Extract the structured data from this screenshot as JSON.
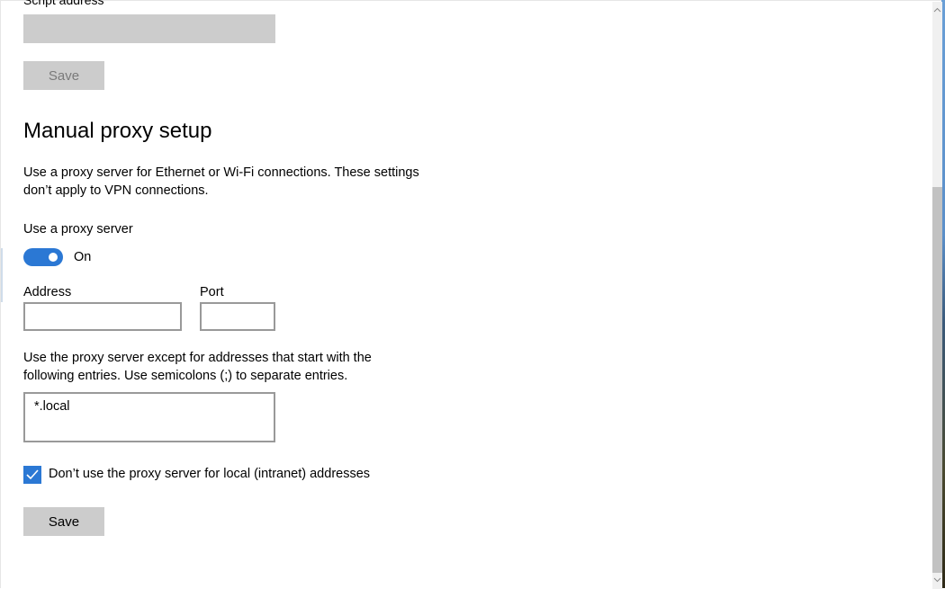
{
  "script_section": {
    "address_label": "Script address",
    "address_value": "",
    "save_label": "Save"
  },
  "manual_proxy": {
    "title": "Manual proxy setup",
    "description": "Use a proxy server for Ethernet or Wi-Fi connections. These settings don’t apply to VPN connections.",
    "use_proxy_label": "Use a proxy server",
    "use_proxy_state": "On",
    "address_label": "Address",
    "address_value": "",
    "port_label": "Port",
    "port_value": "",
    "exceptions_description": "Use the proxy server except for addresses that start with the following entries. Use semicolons (;) to separate entries.",
    "exceptions_value": "*.local",
    "bypass_local_label": "Don’t use the proxy server for local (intranet) addresses",
    "bypass_local_checked": true,
    "save_label": "Save"
  },
  "colors": {
    "accent": "#2b78d4",
    "disabled_fill": "#cccccc"
  },
  "icons": {
    "scroll_up": "chevron-up-icon",
    "scroll_down": "chevron-down-icon",
    "checkbox": "checkmark-icon"
  }
}
